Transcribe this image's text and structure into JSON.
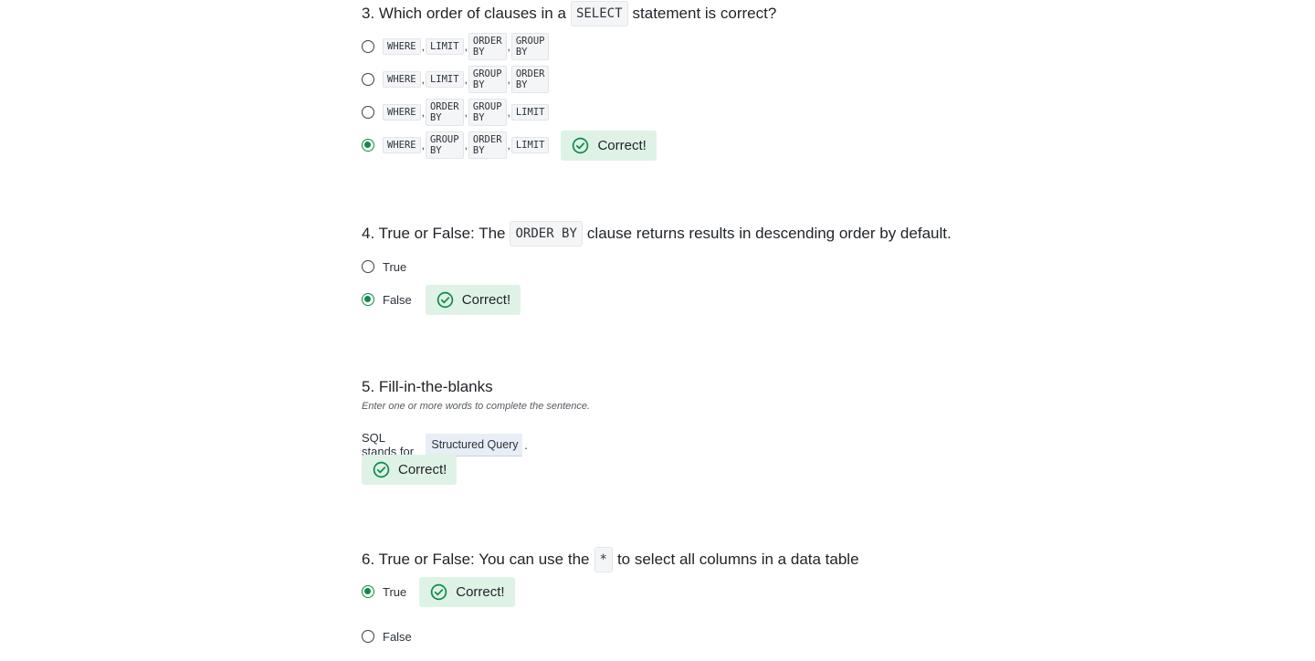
{
  "questions": {
    "q3": {
      "title_before": "3. Which order of clauses in a",
      "title_code": "SELECT",
      "title_after": "statement is correct?",
      "options": [
        {
          "parts": [
            "WHERE",
            "LIMIT",
            "ORDER BY",
            "GROUP BY"
          ],
          "selected": false
        },
        {
          "parts": [
            "WHERE",
            "LIMIT",
            "GROUP BY",
            "ORDER BY"
          ],
          "selected": false
        },
        {
          "parts": [
            "WHERE",
            "ORDER BY",
            "GROUP BY",
            "LIMIT"
          ],
          "selected": false
        },
        {
          "parts": [
            "WHERE",
            "GROUP BY",
            "ORDER BY",
            "LIMIT"
          ],
          "selected": true
        }
      ],
      "feedback": "Correct!"
    },
    "q4": {
      "title_before": "4. True or False: The",
      "title_code": "ORDER BY",
      "title_after": "clause returns results in descending order by default.",
      "options": [
        {
          "label": "True",
          "selected": false
        },
        {
          "label": "False",
          "selected": true
        }
      ],
      "feedback": "Correct!"
    },
    "q5": {
      "title": "5. Fill-in-the-blanks",
      "subtitle": "Enter one or more words to complete the sentence.",
      "sentence_before": "SQL stands for",
      "blank_value": "Structured Query Langu",
      "sentence_after": ".",
      "feedback": "Correct!"
    },
    "q6": {
      "title_before": "6. True or False: You can use the",
      "title_code": "*",
      "title_after": "to select all columns in a data table",
      "options": [
        {
          "label": "True",
          "selected": true
        },
        {
          "label": "False",
          "selected": false
        }
      ],
      "feedback": "Correct!"
    }
  },
  "colors": {
    "accent_green": "#0e8a4a",
    "correct_bg": "#dff2e6"
  },
  "icons": {
    "feedback": "check-circle-icon"
  }
}
